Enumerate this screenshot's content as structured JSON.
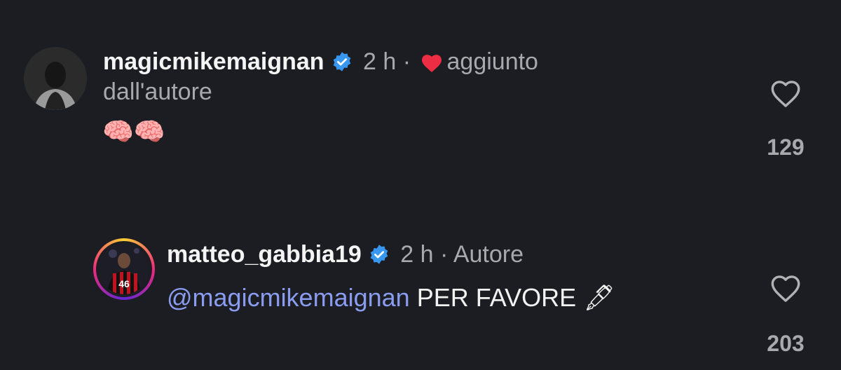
{
  "comments": [
    {
      "username": "magicmikemaignan",
      "time": "2 h",
      "separator": "·",
      "added_by": "aggiunto",
      "added_by_cont": "dall'autore",
      "text": "🧠🧠",
      "likes": "129",
      "verified": true
    },
    {
      "username": "matteo_gabbia19",
      "time": "2 h",
      "separator": "·",
      "role": "Autore",
      "mention": "@magicmikemaignan",
      "text": "PER FAVORE",
      "text_emoji": "🖋",
      "likes": "203",
      "verified": true
    }
  ],
  "colors": {
    "background": "#1c1d22",
    "verified_blue": "#3897f0",
    "mention": "#8a9cf0",
    "heart_red": "#ed2d43",
    "meta_gray": "#a8a8ad"
  },
  "icons": {
    "verified": "verified-badge-icon",
    "added_heart": "heart-filled-icon",
    "like": "heart-outline-icon",
    "pen": "fountain-pen-icon"
  }
}
